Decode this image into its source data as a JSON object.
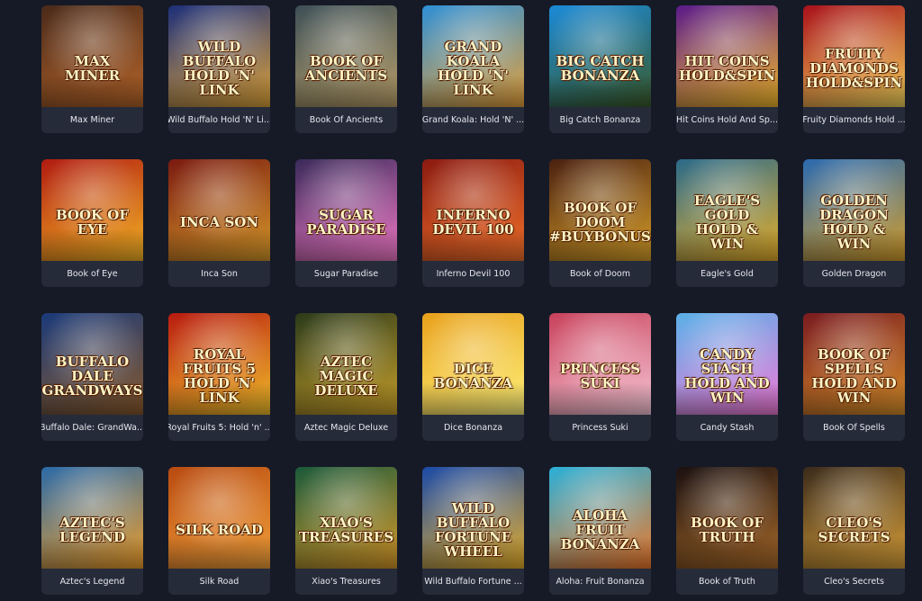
{
  "games": [
    {
      "title": "Max Miner",
      "logo": "MAX MINER",
      "colors": [
        "#4a2a1a",
        "#b5652a"
      ]
    },
    {
      "title": "Wild Buffalo Hold 'N' Li...",
      "logo": "WILD BUFFALO HOLD 'N' LINK",
      "colors": [
        "#1c2f7a",
        "#e0a53a"
      ]
    },
    {
      "title": "Book Of Ancients",
      "logo": "BOOK OF ANCIENTS",
      "colors": [
        "#3d4f56",
        "#b9a06a"
      ]
    },
    {
      "title": "Grand Koala: Hold 'N' ...",
      "logo": "GRAND KOALA HOLD 'N' LINK",
      "colors": [
        "#2d8fd6",
        "#e8a23a"
      ]
    },
    {
      "title": "Big Catch Bonanza",
      "logo": "BIG CATCH BONANZA",
      "colors": [
        "#1a8ad8",
        "#3b5b2a"
      ]
    },
    {
      "title": "Hit Coins Hold And Sp...",
      "logo": "HIT COINS HOLD&SPIN",
      "colors": [
        "#5a1a8a",
        "#f2b92a"
      ]
    },
    {
      "title": "Fruity Diamonds Hold ...",
      "logo": "FRUITY DIAMONDS HOLD&SPIN",
      "colors": [
        "#a8101a",
        "#f2d35a"
      ]
    },
    {
      "title": "Book of Eye",
      "logo": "BOOK OF EYE",
      "colors": [
        "#b01a10",
        "#f5b524"
      ]
    },
    {
      "title": "Inca Son",
      "logo": "INCA SON",
      "colors": [
        "#7a1a10",
        "#d89a2a"
      ]
    },
    {
      "title": "Sugar Paradise",
      "logo": "SUGAR PARADISE",
      "colors": [
        "#3a2a5a",
        "#f27ac8"
      ]
    },
    {
      "title": "Inferno Devil 100",
      "logo": "INFERNO DEVIL 100",
      "colors": [
        "#8a1a10",
        "#f2702a"
      ]
    },
    {
      "title": "Book of Doom",
      "logo": "BOOK OF DOOM #BUYBONUS",
      "colors": [
        "#4a2010",
        "#d8a02a"
      ]
    },
    {
      "title": "Eagle's Gold",
      "logo": "EAGLE'S GOLD HOLD & WIN",
      "colors": [
        "#2a6a8a",
        "#e8b02a"
      ]
    },
    {
      "title": "Golden Dragon",
      "logo": "GOLDEN DRAGON HOLD & WIN",
      "colors": [
        "#2a6ab0",
        "#d8a02a"
      ]
    },
    {
      "title": "Buffalo Dale: GrandWa...",
      "logo": "BUFFALO DALE GRANDWAYS",
      "colors": [
        "#1a3a7a",
        "#8a5a2a"
      ]
    },
    {
      "title": "Royal Fruits 5: Hold 'n' ...",
      "logo": "ROYAL FRUITS 5 HOLD 'N' LINK",
      "colors": [
        "#b81a10",
        "#f2c02a"
      ]
    },
    {
      "title": "Aztec Magic Deluxe",
      "logo": "AZTEC MAGIC DELUXE",
      "colors": [
        "#2a3a1a",
        "#c8a02a"
      ]
    },
    {
      "title": "Dice Bonanza",
      "logo": "DICE BONANZA",
      "colors": [
        "#e8a01a",
        "#fff27a"
      ]
    },
    {
      "title": "Princess Suki",
      "logo": "PRINCESS SUKI",
      "colors": [
        "#c8405a",
        "#f8c8d8"
      ]
    },
    {
      "title": "Candy Stash",
      "logo": "CANDY STASH HOLD AND WIN",
      "colors": [
        "#5ab0e8",
        "#f27ad8"
      ]
    },
    {
      "title": "Book Of Spells",
      "logo": "BOOK OF SPELLS HOLD AND WIN",
      "colors": [
        "#7a1a20",
        "#d8902a"
      ]
    },
    {
      "title": "Aztec's Legend",
      "logo": "AZTEC'S LEGEND",
      "colors": [
        "#2a6aa8",
        "#f2a02a"
      ]
    },
    {
      "title": "Silk Road",
      "logo": "SILK ROAD",
      "colors": [
        "#b84a10",
        "#f2a03a"
      ]
    },
    {
      "title": "Xiao's Treasures",
      "logo": "XIAO'S TREASURES",
      "colors": [
        "#1a5a3a",
        "#d89a2a"
      ]
    },
    {
      "title": "Wild Buffalo Fortune ...",
      "logo": "WILD BUFFALO FORTUNE WHEEL",
      "colors": [
        "#1a4aa8",
        "#e8b02a"
      ]
    },
    {
      "title": "Aloha: Fruit Bonanza",
      "logo": "ALOHA FRUIT BONANZA",
      "colors": [
        "#2ab0d8",
        "#f27a2a"
      ]
    },
    {
      "title": "Book of Truth",
      "logo": "BOOK OF TRUTH",
      "colors": [
        "#1a1010",
        "#a86a2a"
      ]
    },
    {
      "title": "Cleo's Secrets",
      "logo": "CLEO'S SECRETS",
      "colors": [
        "#3a2a1a",
        "#d8a03a"
      ]
    }
  ]
}
